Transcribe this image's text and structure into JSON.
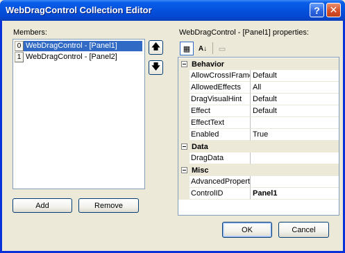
{
  "window": {
    "title": "WebDragControl Collection Editor",
    "help_glyph": "?",
    "close_glyph": "✕"
  },
  "members": {
    "label": "Members:",
    "items": [
      {
        "index": "0",
        "text": "WebDragControl - [Panel1]",
        "selected": true
      },
      {
        "index": "1",
        "text": "WebDragControl - [Panel2]",
        "selected": false
      }
    ],
    "move_up_glyph": "🡅",
    "move_down_glyph": "🡇",
    "add_label": "Add",
    "remove_label": "Remove"
  },
  "properties": {
    "label": "WebDragControl - [Panel1] properties:",
    "toolbar": {
      "categorized_glyph": "▦",
      "alphabetical_glyph": "A↓",
      "pages_glyph": "▭"
    },
    "categories": [
      {
        "name": "Behavior",
        "rows": [
          {
            "name": "AllowCrossIFrame",
            "value": "Default",
            "bold": false
          },
          {
            "name": "AllowedEffects",
            "value": "All",
            "bold": false
          },
          {
            "name": "DragVisualHint",
            "value": "Default",
            "bold": false
          },
          {
            "name": "Effect",
            "value": "Default",
            "bold": false
          },
          {
            "name": "EffectText",
            "value": "",
            "bold": false
          },
          {
            "name": "Enabled",
            "value": "True",
            "bold": false
          }
        ]
      },
      {
        "name": "Data",
        "rows": [
          {
            "name": "DragData",
            "value": "",
            "bold": false
          }
        ]
      },
      {
        "name": "Misc",
        "rows": [
          {
            "name": "AdvancedPropert",
            "value": "",
            "bold": false
          },
          {
            "name": "ControlID",
            "value": "Panel1",
            "bold": true
          }
        ]
      }
    ]
  },
  "footer": {
    "ok_label": "OK",
    "cancel_label": "Cancel"
  }
}
